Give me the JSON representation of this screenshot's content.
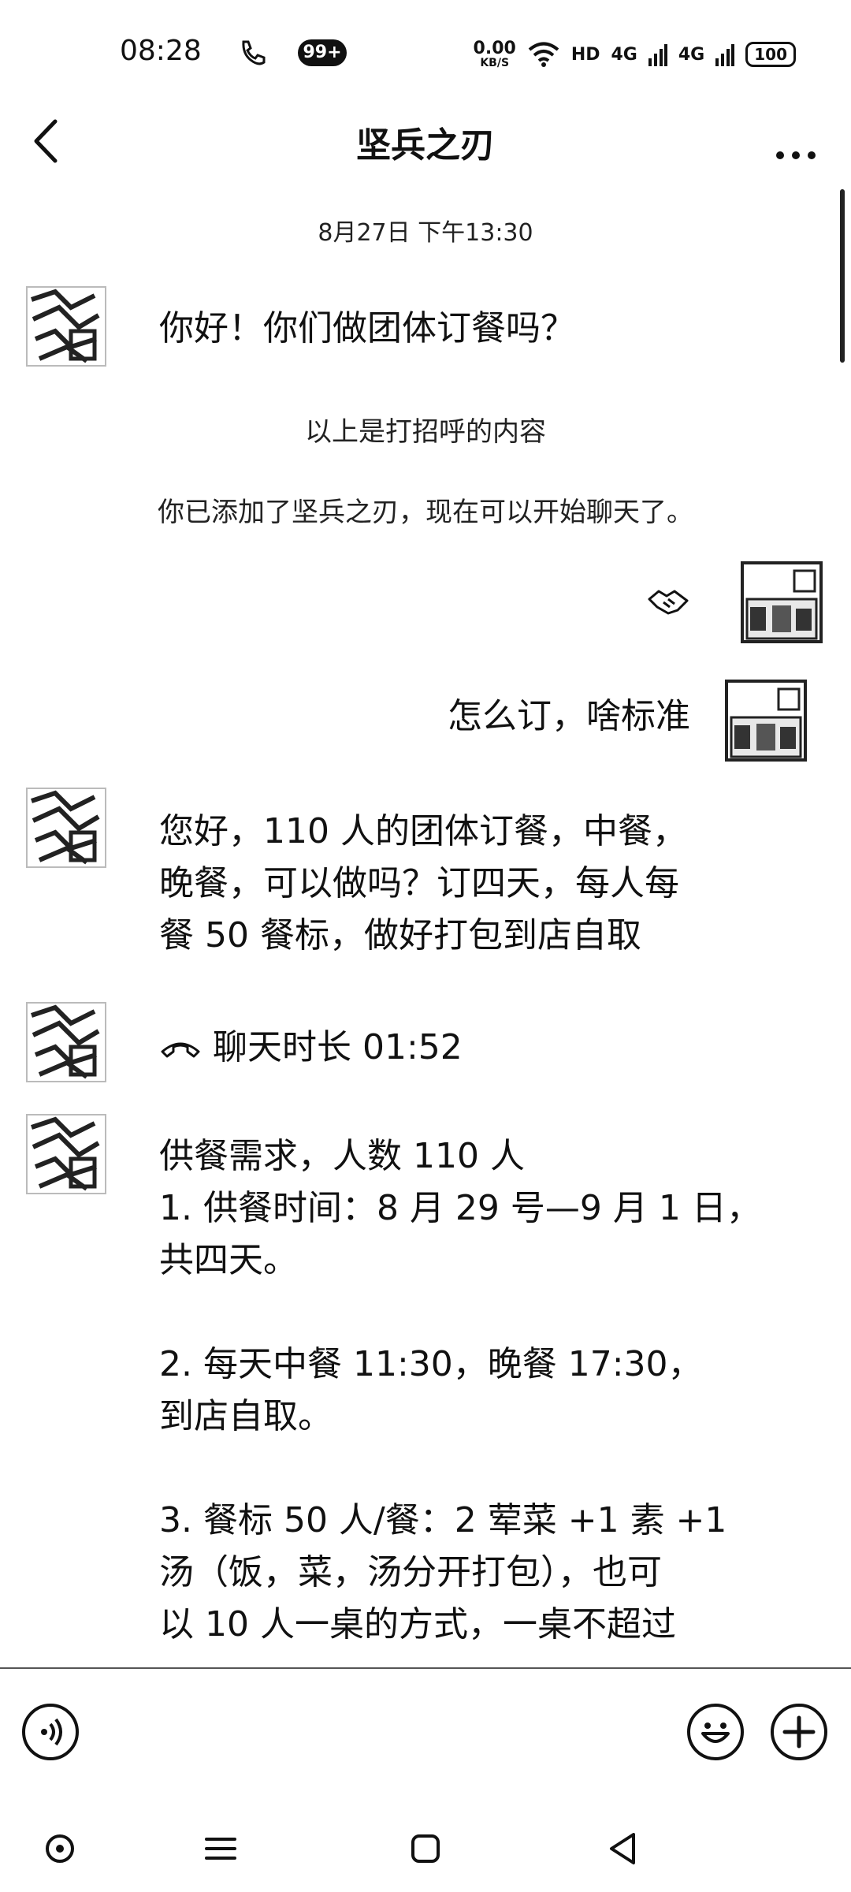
{
  "status_bar": {
    "time": "08:28",
    "badge": "99+",
    "speed_value": "0.00",
    "speed_unit": "KB/S",
    "hd": "HD",
    "net1": "4G",
    "net2": "4G",
    "battery": "100"
  },
  "header": {
    "title": "坚兵之刃"
  },
  "chat": {
    "timestamp": "8月27日 下午13:30",
    "greeting": "你好！你们做团体订餐吗？",
    "system_1": "以上是打招呼的内容",
    "system_2": "你已添加了坚兵之刃，现在可以开始聊天了。",
    "sent_1": "怎么订，啥标准",
    "recv_1": "您好，110 人的团体订餐，中餐，\n晚餐，可以做吗？订四天，每人每\n餐 50 餐标，做好打包到店自取",
    "call_duration": "聊天时长 01:52",
    "recv_2": "供餐需求，人数 110 人\n1. 供餐时间：8 月 29 号—9 月 1 日，\n共四天。\n\n2. 每天中餐 11:30，晚餐 17:30，\n到店自取。\n\n3. 餐标 50 人/餐：2 荤菜 +1 素 +1\n汤（饭，菜，汤分开打包），也可\n以 10 人一桌的方式，一桌不超过"
  },
  "icons": {
    "back": "chevron-left-icon",
    "more": "more-dots-icon",
    "handshake": "handshake-icon",
    "phone": "phone-hangup-icon",
    "voice": "voice-icon",
    "emoji": "emoji-icon",
    "plus": "plus-icon"
  }
}
